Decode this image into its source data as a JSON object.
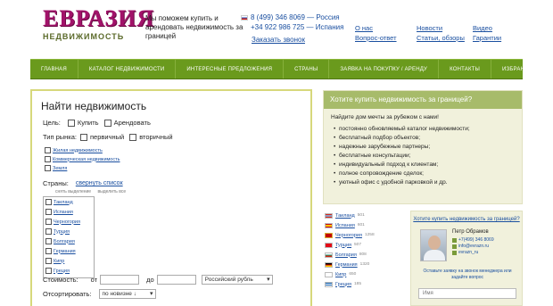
{
  "header": {
    "logo_main": "ЕВРАЗИЯ",
    "logo_sub": "НЕДВИЖИМОСТЬ",
    "tagline": "Мы поможем купить и арендовать недвижимость за границей",
    "phone_ru": "8 (499) 346 8069 — Россия",
    "phone_es": "+34 922 986 725 — Испания",
    "callback": "Заказать звонок",
    "links_col1": [
      "О нас",
      "Вопрос-ответ"
    ],
    "links_col2": [
      "Новости",
      "Статьи, обзоры"
    ],
    "links_col3": [
      "Видео",
      "Гарантии"
    ]
  },
  "nav": [
    "Главная",
    "Каталог недвижимости",
    "Интересные предложения",
    "Страны",
    "Заявка на покупку / аренду",
    "Контакты",
    "Избранное"
  ],
  "search": {
    "title": "Найти недвижимость",
    "goal_label": "Цель:",
    "goal_buy": "Купить",
    "goal_rent": "Арендовать",
    "market_label": "Тип рынка:",
    "market_primary": "первичный",
    "market_secondary": "вторичный",
    "property_types": [
      "Жилая недвижимость",
      "Коммерческая недвижимость",
      "Земля"
    ],
    "countries_label": "Страны:",
    "collapse": "свернуть список",
    "remove_sel": "снять выделение",
    "select_all": "выделить все",
    "countries": [
      "Таиланд",
      "Испания",
      "Черногория",
      "Турция",
      "Болгария",
      "Германия",
      "Кипр",
      "Греция"
    ],
    "price_label": "Стоимость:",
    "from": "от",
    "to": "до",
    "currency": "Российский рубль",
    "sort_label": "Отсортировать:",
    "sort_value": "по новизне ↓"
  },
  "promo": {
    "head": "Хотите купить недвижимость за границей?",
    "sub": "Найдите дом мечты за рубежом с нами!",
    "items": [
      "постоянно обновляемый каталог недвижимости;",
      "бесплатный подбор объектов;",
      "надежные зарубежные партнеры;",
      "бесплатные консультации;",
      "индивидуальный подход к клиентам;",
      "полное сопровождение сделок;",
      "уютный офис с удобной парковкой и др."
    ]
  },
  "country_list": [
    {
      "name": "Таиланд",
      "count": "501"
    },
    {
      "name": "Испания",
      "count": "601"
    },
    {
      "name": "Черногория",
      "count": "1258"
    },
    {
      "name": "Турция",
      "count": "507"
    },
    {
      "name": "Болгария",
      "count": "808"
    },
    {
      "name": "Германия",
      "count": "1320"
    },
    {
      "name": "Кипр",
      "count": "650"
    },
    {
      "name": "Греция",
      "count": "185"
    }
  ],
  "ask": {
    "head": "Хотите купить недвижимость за границей?",
    "agent_name": "Петр Обрамов",
    "phone": "+7(499) 346 8069",
    "email": "info@evrazn.ru",
    "skype": "evrazn_ru",
    "note": "Оставьте заявку на звонок менеджера или задайте вопрос",
    "name_placeholder": "Имя"
  },
  "colors": {
    "brand": "#a2126a",
    "nav": "#6a9a1d",
    "link": "#1a4fa0",
    "promo_head": "#a7bb6a"
  }
}
